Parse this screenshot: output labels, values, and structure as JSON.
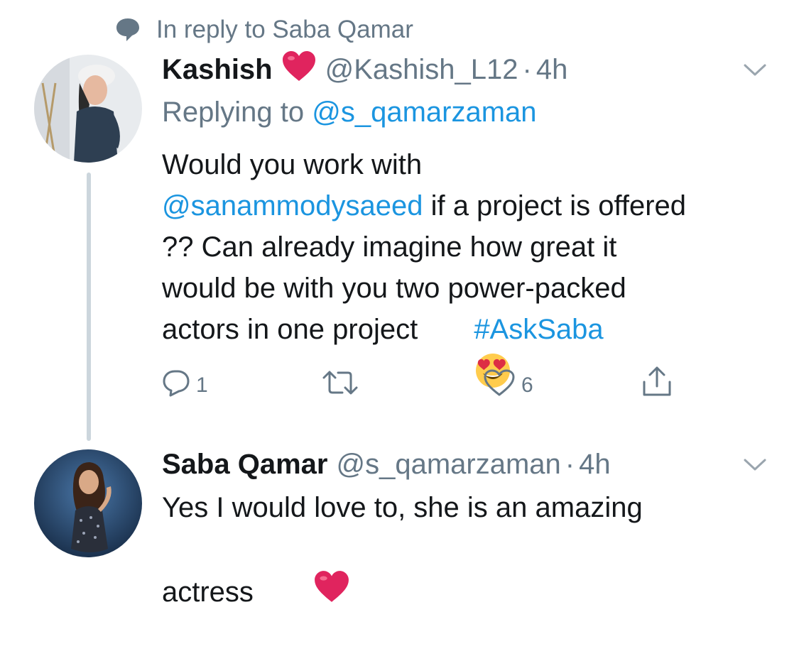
{
  "context": {
    "text": "In reply to Saba Qamar",
    "icon": "speech-bubble-icon"
  },
  "tweet1": {
    "name": "Kashish",
    "name_emoji": "red-heart-icon",
    "handle": "@Kashish_L12",
    "separator": "·",
    "time": "4h",
    "replying_prefix": "Replying to ",
    "replying_handle": "@s_qamarzaman",
    "body": {
      "line1": "Would you work with",
      "mention": "@sanammodysaeed",
      "line2_rest": " if a project is offered",
      "line3": "?? Can already imagine how great it",
      "line4": "would be with you two power-packed",
      "line5": "actors in one project ",
      "emoji": "heart-eyes-emoji",
      "hashtag": "#AskSaba"
    },
    "actions": {
      "reply_count": "1",
      "retweet_count": "",
      "like_count": "6"
    }
  },
  "tweet2": {
    "name": "Saba Qamar",
    "handle": "@s_qamarzaman",
    "separator": "·",
    "time": "4h",
    "body": {
      "line1": "Yes I would love to, she is an amazing",
      "line2": "actress ",
      "emoji": "red-heart-icon"
    }
  },
  "colors": {
    "link": "#1b95e0",
    "muted": "#657786",
    "text": "#14171a",
    "thread_line": "#ccd6dd",
    "heart": "#e0245e"
  }
}
